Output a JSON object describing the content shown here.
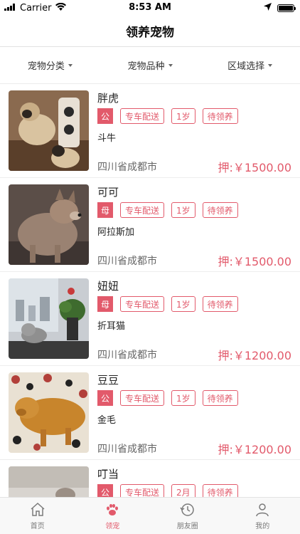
{
  "status_bar": {
    "carrier": "Carrier",
    "time": "8:53 AM"
  },
  "nav": {
    "title": "领养宠物"
  },
  "filters": [
    {
      "label": "宠物分类"
    },
    {
      "label": "宠物品种"
    },
    {
      "label": "区域选择"
    }
  ],
  "pets": [
    {
      "name": "胖虎",
      "gender": "公",
      "delivery": "专车配送",
      "age": "1岁",
      "status": "待领养",
      "breed": "斗牛",
      "location": "四川省成都市",
      "price": "押:￥1500.00",
      "photo": "pug"
    },
    {
      "name": "可可",
      "gender": "母",
      "delivery": "专车配送",
      "age": "1岁",
      "status": "待领养",
      "breed": "阿拉斯加",
      "location": "四川省成都市",
      "price": "押:￥1500.00",
      "photo": "alaskan"
    },
    {
      "name": "妞妞",
      "gender": "母",
      "delivery": "专车配送",
      "age": "1岁",
      "status": "待领养",
      "breed": "折耳猫",
      "location": "四川省成都市",
      "price": "押:￥1200.00",
      "photo": "cat"
    },
    {
      "name": "豆豆",
      "gender": "公",
      "delivery": "专车配送",
      "age": "1岁",
      "status": "待领养",
      "breed": "金毛",
      "location": "四川省成都市",
      "price": "押:￥1200.00",
      "photo": "golden"
    },
    {
      "name": "叮当",
      "gender": "公",
      "delivery": "专车配送",
      "age": "2月",
      "status": "待领养",
      "breed": "",
      "location": "",
      "price": "",
      "photo": "kitten"
    }
  ],
  "tabs": [
    {
      "label": "首页",
      "icon": "home-icon",
      "active": false
    },
    {
      "label": "领宠",
      "icon": "paw-icon",
      "active": true
    },
    {
      "label": "朋友圈",
      "icon": "history-icon",
      "active": false
    },
    {
      "label": "我的",
      "icon": "user-icon",
      "active": false
    }
  ],
  "colors": {
    "accent": "#e25a6b",
    "tab_inactive": "#7a7a7a"
  }
}
